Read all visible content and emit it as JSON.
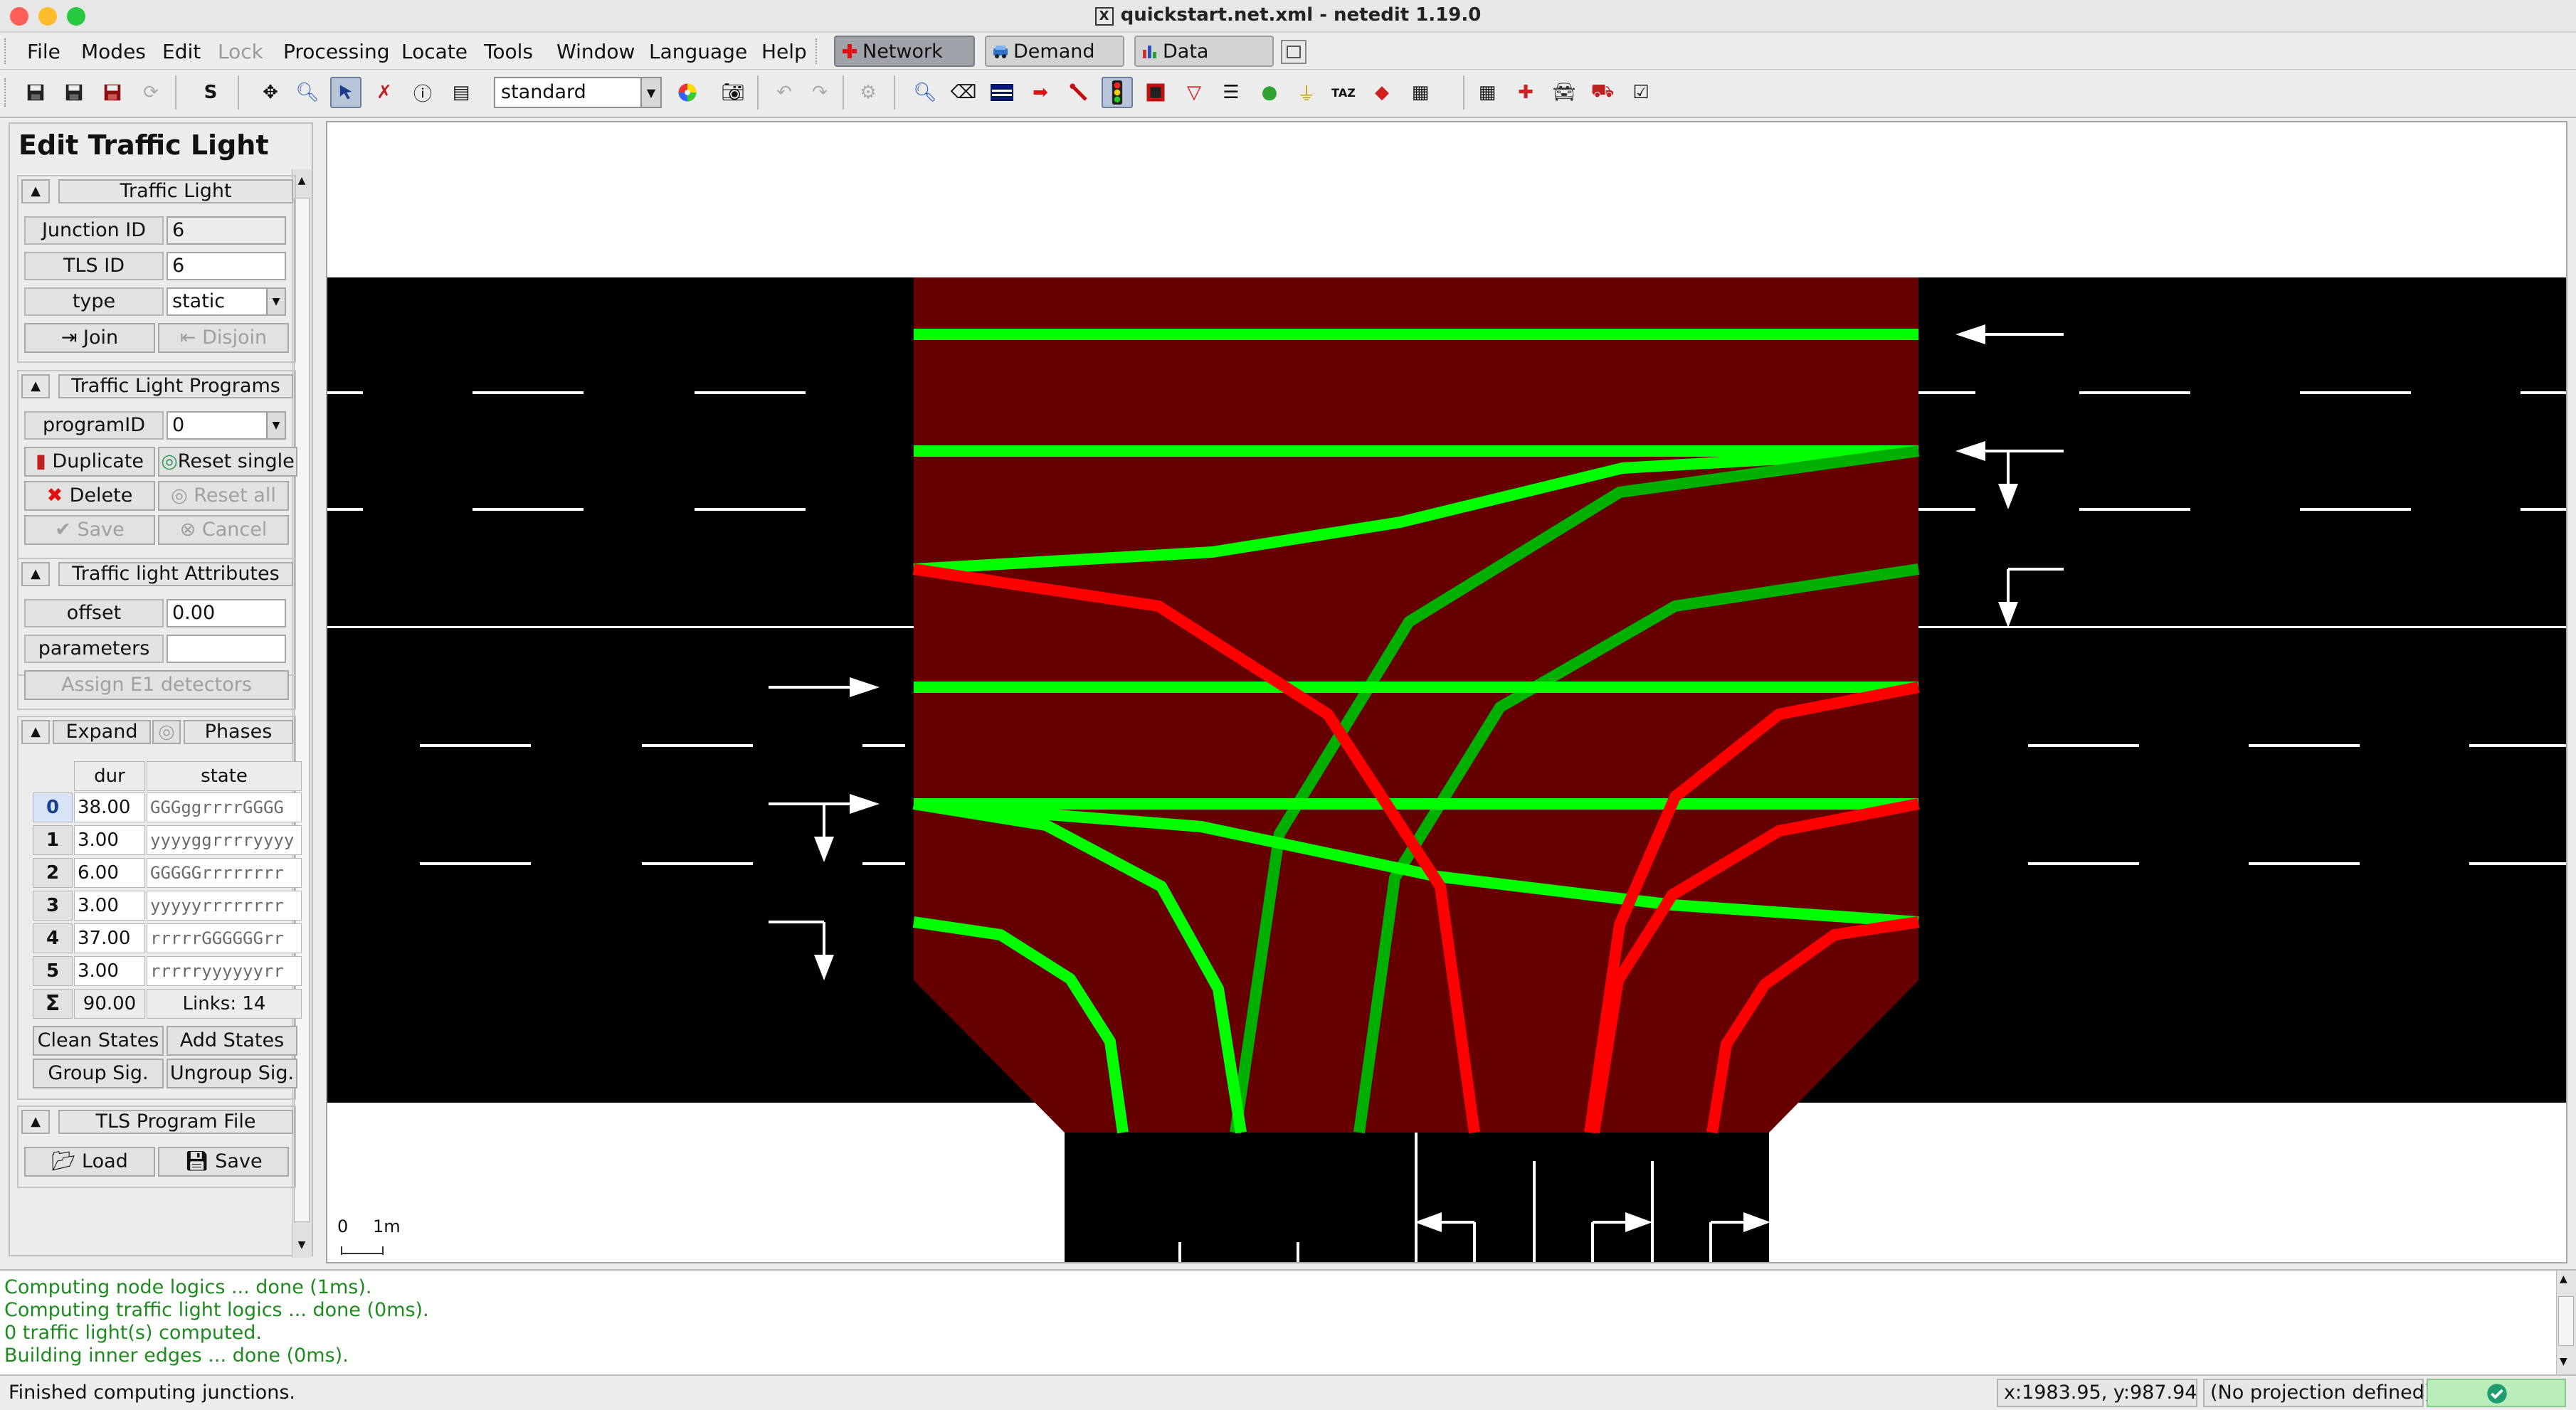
{
  "window": {
    "title": "quickstart.net.xml - netedit 1.19.0"
  },
  "menubar": {
    "items": [
      {
        "label": "File"
      },
      {
        "label": "Modes"
      },
      {
        "label": "Edit"
      },
      {
        "label": "Lock"
      },
      {
        "label": "Processing"
      },
      {
        "label": "Locate"
      },
      {
        "label": "Tools"
      },
      {
        "label": "Window"
      },
      {
        "label": "Language"
      },
      {
        "label": "Help"
      }
    ],
    "supermodes": [
      {
        "label": "Network"
      },
      {
        "label": "Demand"
      },
      {
        "label": "Data"
      }
    ]
  },
  "toolbar": {
    "scheme": "standard"
  },
  "panel": {
    "title": "Edit Traffic Light",
    "traffic_light": {
      "header": "Traffic Light",
      "junction_label": "Junction ID",
      "junction_value": "6",
      "tls_label": "TLS ID",
      "tls_value": "6",
      "type_label": "type",
      "type_value": "static",
      "join": "Join",
      "disjoin": "Disjoin"
    },
    "programs": {
      "header": "Traffic Light Programs",
      "program_label": "programID",
      "program_value": "0",
      "duplicate": "Duplicate",
      "reset_single": "Reset single",
      "delete": "Delete",
      "reset_all": "Reset all",
      "save": "Save",
      "cancel": "Cancel"
    },
    "attributes": {
      "header": "Traffic light Attributes",
      "offset_label": "offset",
      "offset_value": "0.00",
      "parameters_label": "parameters",
      "parameters_value": "",
      "assign": "Assign E1 detectors"
    },
    "phases": {
      "expand": "Expand",
      "header": "Phases",
      "col_dur": "dur",
      "col_state": "state",
      "rows": [
        {
          "idx": "0",
          "dur": "38.00",
          "state": "GGGggrrrrGGGG"
        },
        {
          "idx": "1",
          "dur": "3.00",
          "state": "yyyyggrrrryyyy"
        },
        {
          "idx": "2",
          "dur": "6.00",
          "state": "GGGGGrrrrrrrr"
        },
        {
          "idx": "3",
          "dur": "3.00",
          "state": "yyyyyrrrrrrrr"
        },
        {
          "idx": "4",
          "dur": "37.00",
          "state": "rrrrrGGGGGGrr"
        },
        {
          "idx": "5",
          "dur": "3.00",
          "state": "rrrrryyyyyyrr"
        }
      ],
      "sum_symbol": "Σ",
      "sum": "90.00",
      "links": "Links: 14",
      "clean": "Clean States",
      "add": "Add States",
      "group": "Group Sig.",
      "ungroup": "Ungroup Sig."
    },
    "program_file": {
      "header": "TLS Program File",
      "load": "Load",
      "save": "Save"
    }
  },
  "canvas": {
    "scale_zero": "0",
    "scale_unit": "1m"
  },
  "log": [
    "Computing node logics ... done (1ms).",
    "Computing traffic light logics ... done (0ms).",
    " 0 traffic light(s) computed.",
    "Building inner edges ... done (0ms)."
  ],
  "status": {
    "message": "Finished computing junctions.",
    "coords": "x:1983.95, y:987.94",
    "projection": "(No projection defined)"
  },
  "colors": {
    "junction": "#660000",
    "green": "#00ff00",
    "dark_green": "#00b000",
    "red": "#ff0000"
  }
}
